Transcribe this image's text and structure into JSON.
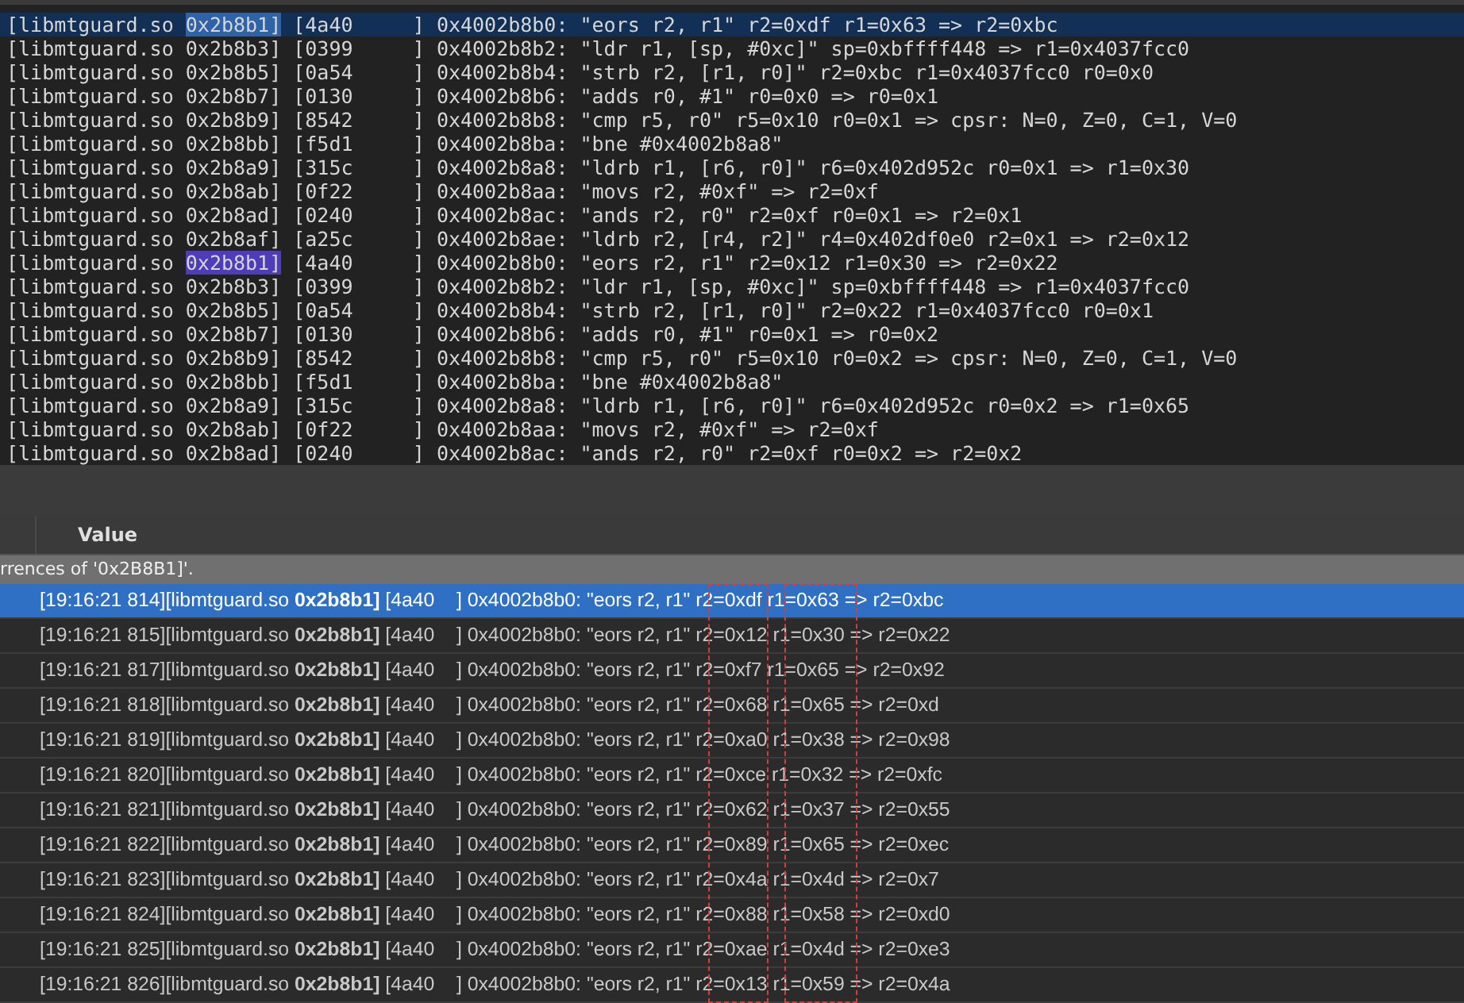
{
  "editor": {
    "lines": [
      {
        "module": "[libmtguard.so ",
        "offset": "0x2b8b1]",
        "rest": " [4a40     ] 0x4002b8b0: \"eors r2, r1\" r2=0xdf r1=0x63 => r2=0xbc",
        "current": true,
        "match": true
      },
      {
        "module": "[libmtguard.so ",
        "offset": "0x2b8b3]",
        "rest": " [0399     ] 0x4002b8b2: \"ldr r1, [sp, #0xc]\" sp=0xbffff448 => r1=0x4037fcc0",
        "current": false,
        "match": false
      },
      {
        "module": "[libmtguard.so ",
        "offset": "0x2b8b5]",
        "rest": " [0a54     ] 0x4002b8b4: \"strb r2, [r1, r0]\" r2=0xbc r1=0x4037fcc0 r0=0x0",
        "current": false,
        "match": false
      },
      {
        "module": "[libmtguard.so ",
        "offset": "0x2b8b7]",
        "rest": " [0130     ] 0x4002b8b6: \"adds r0, #1\" r0=0x0 => r0=0x1",
        "current": false,
        "match": false
      },
      {
        "module": "[libmtguard.so ",
        "offset": "0x2b8b9]",
        "rest": " [8542     ] 0x4002b8b8: \"cmp r5, r0\" r5=0x10 r0=0x1 => cpsr: N=0, Z=0, C=1, V=0",
        "current": false,
        "match": false
      },
      {
        "module": "[libmtguard.so ",
        "offset": "0x2b8bb]",
        "rest": " [f5d1     ] 0x4002b8ba: \"bne #0x4002b8a8\"",
        "current": false,
        "match": false
      },
      {
        "module": "[libmtguard.so ",
        "offset": "0x2b8a9]",
        "rest": " [315c     ] 0x4002b8a8: \"ldrb r1, [r6, r0]\" r6=0x402d952c r0=0x1 => r1=0x30",
        "current": false,
        "match": false
      },
      {
        "module": "[libmtguard.so ",
        "offset": "0x2b8ab]",
        "rest": " [0f22     ] 0x4002b8aa: \"movs r2, #0xf\" => r2=0xf",
        "current": false,
        "match": false
      },
      {
        "module": "[libmtguard.so ",
        "offset": "0x2b8ad]",
        "rest": " [0240     ] 0x4002b8ac: \"ands r2, r0\" r2=0xf r0=0x1 => r2=0x1",
        "current": false,
        "match": false
      },
      {
        "module": "[libmtguard.so ",
        "offset": "0x2b8af]",
        "rest": " [a25c     ] 0x4002b8ae: \"ldrb r2, [r4, r2]\" r4=0x402df0e0 r2=0x1 => r2=0x12",
        "current": false,
        "match": false
      },
      {
        "module": "[libmtguard.so ",
        "offset": "0x2b8b1]",
        "rest": " [4a40     ] 0x4002b8b0: \"eors r2, r1\" r2=0x12 r1=0x30 => r2=0x22",
        "current": false,
        "match": true
      },
      {
        "module": "[libmtguard.so ",
        "offset": "0x2b8b3]",
        "rest": " [0399     ] 0x4002b8b2: \"ldr r1, [sp, #0xc]\" sp=0xbffff448 => r1=0x4037fcc0",
        "current": false,
        "match": false
      },
      {
        "module": "[libmtguard.so ",
        "offset": "0x2b8b5]",
        "rest": " [0a54     ] 0x4002b8b4: \"strb r2, [r1, r0]\" r2=0x22 r1=0x4037fcc0 r0=0x1",
        "current": false,
        "match": false
      },
      {
        "module": "[libmtguard.so ",
        "offset": "0x2b8b7]",
        "rest": " [0130     ] 0x4002b8b6: \"adds r0, #1\" r0=0x1 => r0=0x2",
        "current": false,
        "match": false
      },
      {
        "module": "[libmtguard.so ",
        "offset": "0x2b8b9]",
        "rest": " [8542     ] 0x4002b8b8: \"cmp r5, r0\" r5=0x10 r0=0x2 => cpsr: N=0, Z=0, C=1, V=0",
        "current": false,
        "match": false
      },
      {
        "module": "[libmtguard.so ",
        "offset": "0x2b8bb]",
        "rest": " [f5d1     ] 0x4002b8ba: \"bne #0x4002b8a8\"",
        "current": false,
        "match": false
      },
      {
        "module": "[libmtguard.so ",
        "offset": "0x2b8a9]",
        "rest": " [315c     ] 0x4002b8a8: \"ldrb r1, [r6, r0]\" r6=0x402d952c r0=0x2 => r1=0x65",
        "current": false,
        "match": false
      },
      {
        "module": "[libmtguard.so ",
        "offset": "0x2b8ab]",
        "rest": " [0f22     ] 0x4002b8aa: \"movs r2, #0xf\" => r2=0xf",
        "current": false,
        "match": false
      },
      {
        "module": "[libmtguard.so ",
        "offset": "0x2b8ad]",
        "rest": " [0240     ] 0x4002b8ac: \"ands r2, r0\" r2=0xf r0=0x2 => r2=0x2",
        "current": false,
        "match": false
      }
    ]
  },
  "results": {
    "column_header": "Value",
    "summary": "rrences of '0x2B8B1]'.",
    "rows": [
      {
        "text": "[19:16:21 814][libmtguard.so **0x2b8b1]** [4a40    ] 0x4002b8b0: \"eors r2, r1\" r2=0xdf r1=0x63 => r2=0xbc",
        "selected": true
      },
      {
        "text": "[19:16:21 815][libmtguard.so **0x2b8b1]** [4a40    ] 0x4002b8b0: \"eors r2, r1\" r2=0x12 r1=0x30 => r2=0x22",
        "selected": false
      },
      {
        "text": "[19:16:21 817][libmtguard.so **0x2b8b1]** [4a40    ] 0x4002b8b0: \"eors r2, r1\" r2=0xf7 r1=0x65 => r2=0x92",
        "selected": false
      },
      {
        "text": "[19:16:21 818][libmtguard.so **0x2b8b1]** [4a40    ] 0x4002b8b0: \"eors r2, r1\" r2=0x68 r1=0x65 => r2=0xd",
        "selected": false
      },
      {
        "text": "[19:16:21 819][libmtguard.so **0x2b8b1]** [4a40    ] 0x4002b8b0: \"eors r2, r1\" r2=0xa0 r1=0x38 => r2=0x98",
        "selected": false
      },
      {
        "text": "[19:16:21 820][libmtguard.so **0x2b8b1]** [4a40    ] 0x4002b8b0: \"eors r2, r1\" r2=0xce r1=0x32 => r2=0xfc",
        "selected": false
      },
      {
        "text": "[19:16:21 821][libmtguard.so **0x2b8b1]** [4a40    ] 0x4002b8b0: \"eors r2, r1\" r2=0x62 r1=0x37 => r2=0x55",
        "selected": false
      },
      {
        "text": "[19:16:21 822][libmtguard.so **0x2b8b1]** [4a40    ] 0x4002b8b0: \"eors r2, r1\" r2=0x89 r1=0x65 => r2=0xec",
        "selected": false
      },
      {
        "text": "[19:16:21 823][libmtguard.so **0x2b8b1]** [4a40    ] 0x4002b8b0: \"eors r2, r1\" r2=0x4a r1=0x4d => r2=0x7",
        "selected": false
      },
      {
        "text": "[19:16:21 824][libmtguard.so **0x2b8b1]** [4a40    ] 0x4002b8b0: \"eors r2, r1\" r2=0x88 r1=0x58 => r2=0xd0",
        "selected": false
      },
      {
        "text": "[19:16:21 825][libmtguard.so **0x2b8b1]** [4a40    ] 0x4002b8b0: \"eors r2, r1\" r2=0xae r1=0x4d => r2=0xe3",
        "selected": false
      },
      {
        "text": "[19:16:21 826][libmtguard.so **0x2b8b1]** [4a40    ] 0x4002b8b0: \"eors r2, r1\" r2=0x13 r1=0x59 => r2=0x4a",
        "selected": false
      }
    ]
  }
}
